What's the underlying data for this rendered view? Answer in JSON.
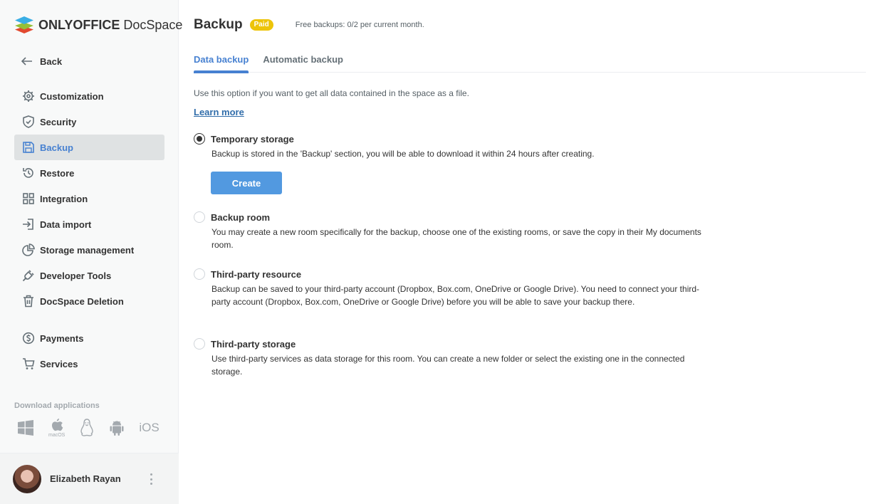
{
  "brand": {
    "name_bold": "ONLYOFFICE",
    "name_regular": "DocSpace"
  },
  "sidebar": {
    "back_label": "Back",
    "items": [
      {
        "label": "Customization",
        "icon": "gear-icon"
      },
      {
        "label": "Security",
        "icon": "shield-icon"
      },
      {
        "label": "Backup",
        "icon": "floppy-disk-icon",
        "active": true
      },
      {
        "label": "Restore",
        "icon": "history-icon"
      },
      {
        "label": "Integration",
        "icon": "grid-icon"
      },
      {
        "label": "Data import",
        "icon": "import-icon"
      },
      {
        "label": "Storage management",
        "icon": "pie-chart-icon"
      },
      {
        "label": "Developer Tools",
        "icon": "plug-icon"
      },
      {
        "label": "DocSpace Deletion",
        "icon": "trash-icon"
      }
    ],
    "secondary_items": [
      {
        "label": "Payments",
        "icon": "dollar-circle-icon"
      },
      {
        "label": "Services",
        "icon": "cart-icon"
      }
    ],
    "download_title": "Download applications",
    "download_icons": [
      "windows-icon",
      "macos-icon",
      "linux-icon",
      "android-icon",
      "ios-icon"
    ],
    "macos_label": "macOS",
    "ios_label": "iOS"
  },
  "user": {
    "name": "Elizabeth Rayan"
  },
  "page": {
    "title": "Backup",
    "badge": "Paid",
    "free_backups": "Free backups: 0/2 per current month.",
    "tabs": [
      {
        "label": "Data backup",
        "active": true
      },
      {
        "label": "Automatic backup",
        "active": false
      }
    ],
    "description": "Use this option if you want to get all data contained in the space as a file.",
    "learn_more": "Learn more",
    "options": [
      {
        "label": "Temporary storage",
        "desc": "Backup is stored in the 'Backup' section, you will be able to download it within 24 hours after creating.",
        "checked": true
      },
      {
        "label": "Backup room",
        "desc": "You may create a new room specifically for the backup, choose one of the existing rooms, or save the copy in their My documents room.",
        "checked": false
      },
      {
        "label": "Third-party resource",
        "desc": "Backup can be saved to your third-party account (Dropbox, Box.com, OneDrive or Google Drive). You need to connect your third-party account (Dropbox, Box.com, OneDrive or Google Drive) before you will be able to save your backup there.",
        "checked": false
      },
      {
        "label": "Third-party storage",
        "desc": "Use third-party services as data storage for this room. You can create a new folder or select the existing one in the connected storage.",
        "checked": false
      }
    ],
    "create_button": "Create"
  },
  "colors": {
    "accent": "#4781d1",
    "button": "#5299e0",
    "badge": "#edc409",
    "active_nav_bg": "#dfe2e3"
  }
}
